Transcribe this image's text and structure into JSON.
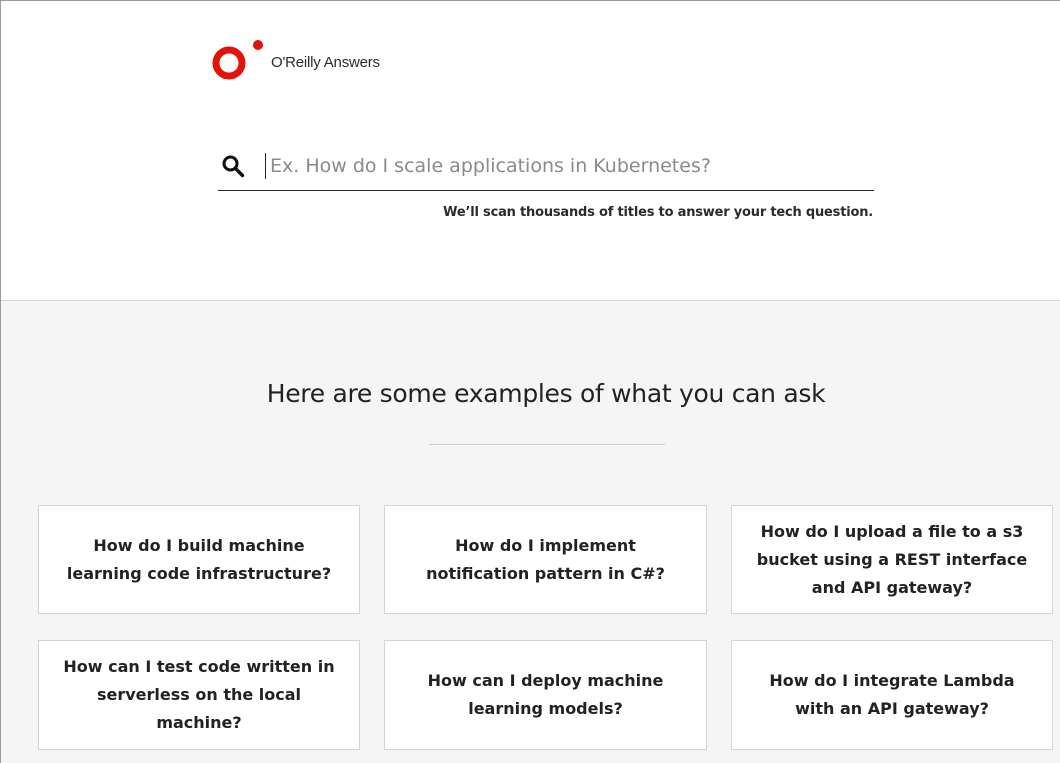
{
  "brand": {
    "name": "O'Reilly Answers",
    "logo_color": "#e3120b"
  },
  "search": {
    "placeholder": "Ex. How do I scale applications in Kubernetes?",
    "value": "",
    "hint": "We’ll scan thousands of titles to answer your tech question.",
    "icon": "search-icon"
  },
  "examples": {
    "heading": "Here are some examples of what you can ask",
    "items": [
      {
        "label": "How do I build machine learning code infrastructure?"
      },
      {
        "label": "How do I implement notification pattern in C#?"
      },
      {
        "label": "How do I upload a file to a s3 bucket using a REST interface and API gateway?"
      },
      {
        "label": "How can I test code written in serverless on the local machine?"
      },
      {
        "label": "How can I deploy machine learning models?"
      },
      {
        "label": "How do I integrate Lambda with an API gateway?"
      }
    ]
  }
}
